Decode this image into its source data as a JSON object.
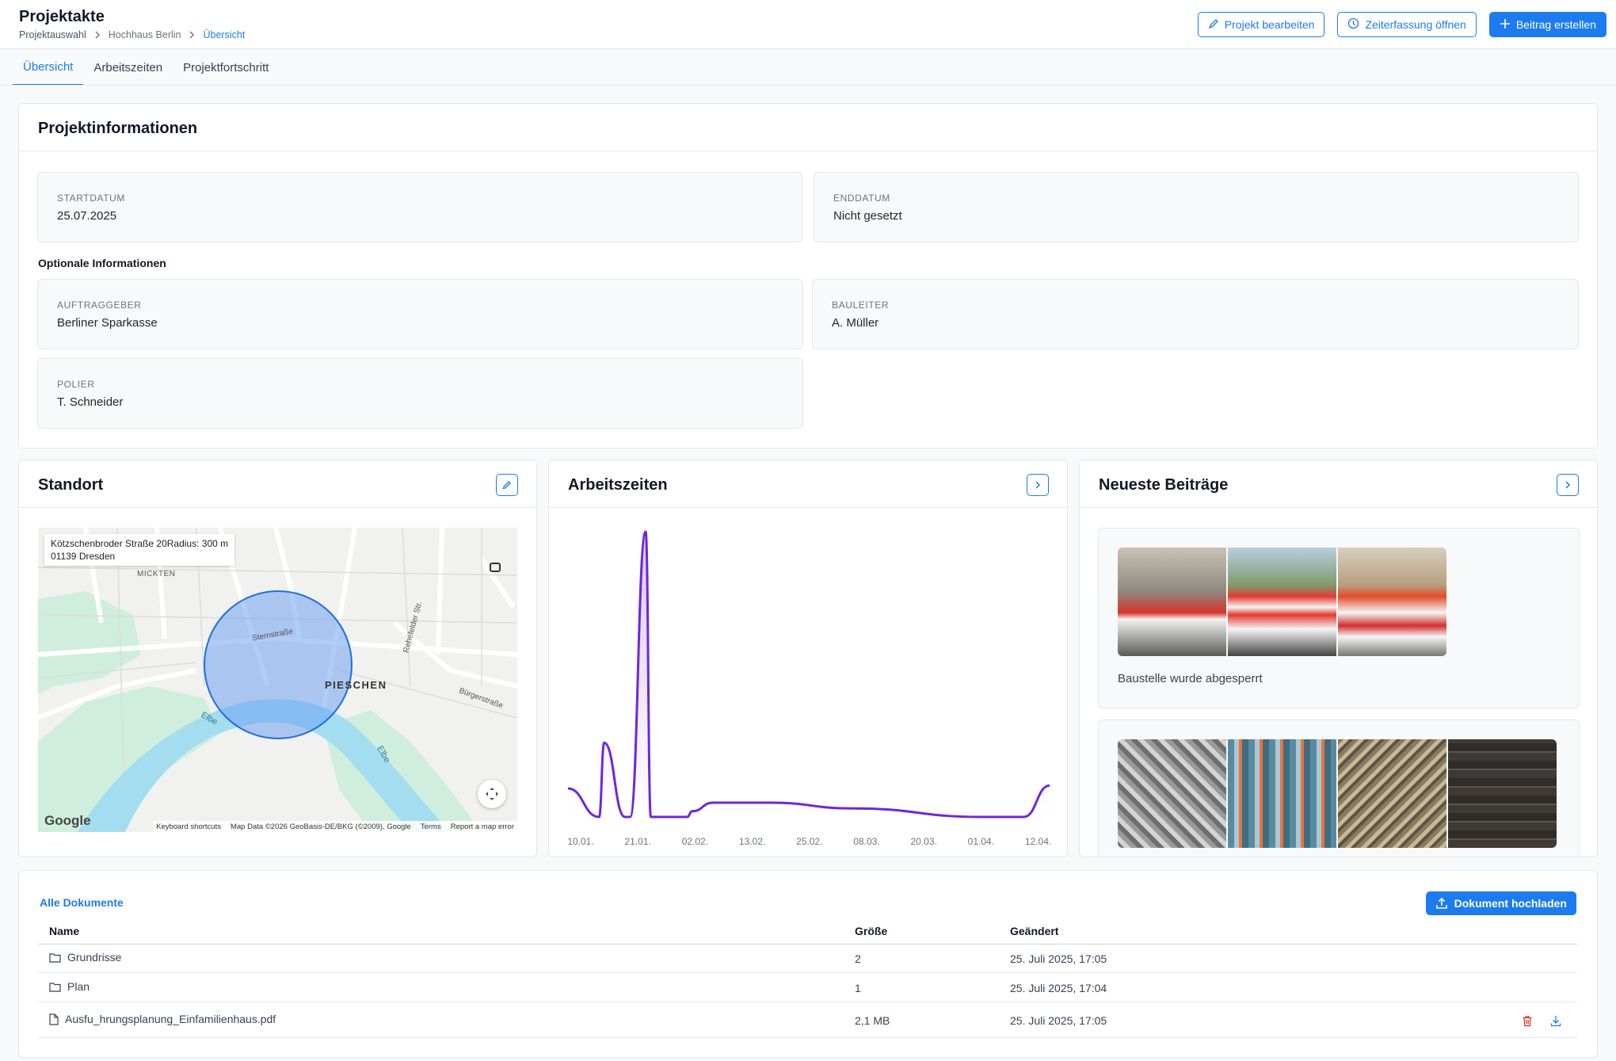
{
  "header": {
    "title": "Projektakte",
    "breadcrumb": [
      "Projektauswahl",
      "Hochhaus Berlin",
      "Übersicht"
    ],
    "actions": {
      "edit": "Projekt bearbeiten",
      "time": "Zeiterfassung öffnen",
      "create": "Beitrag erstellen"
    }
  },
  "tabs": [
    "Übersicht",
    "Arbeitszeiten",
    "Projektfortschritt"
  ],
  "project_info": {
    "title": "Projektinformationen",
    "start_label": "STARTDATUM",
    "start_value": "25.07.2025",
    "end_label": "ENDDATUM",
    "end_value": "Nicht gesetzt",
    "optional_title": "Optionale Informationen",
    "client_label": "AUFTRAGGEBER",
    "client_value": "Berliner Sparkasse",
    "manager_label": "BAULEITER",
    "manager_value": "A. Müller",
    "foreman_label": "POLIER",
    "foreman_value": "T. Schneider"
  },
  "location": {
    "title": "Standort",
    "address_line1": "Kötzschenbroder Straße 20Radius: 300 m",
    "address_line2": "01139 Dresden",
    "labels": {
      "mickten": "MICKTEN",
      "pieschen": "PIESCHEN",
      "sternstrasse": "Sternstraße",
      "rehefelder": "Rehefelder Str.",
      "buergerstrasse": "Bürgerstraße",
      "elbe1": "Elbe",
      "elbe2": "Elbe"
    },
    "google": "Google",
    "footer": [
      "Keyboard shortcuts",
      "Map Data ©2026 GeoBasis-DE/BKG (©2009), Google",
      "Terms",
      "Report a map error"
    ]
  },
  "worktime": {
    "title": "Arbeitszeiten"
  },
  "chart_data": {
    "type": "area",
    "x_ticks": [
      "10.01.",
      "21.01.",
      "02.02.",
      "13.02.",
      "25.02.",
      "08.03.",
      "20.03.",
      "01.04.",
      "12.04."
    ],
    "x": [
      0,
      6,
      7,
      11,
      12,
      15,
      16,
      23,
      24,
      28,
      39,
      55,
      80,
      88,
      93
    ],
    "values": [
      0.1,
      0.0,
      0.26,
      0.0,
      0.0,
      1.0,
      0.0,
      0.0,
      0.02,
      0.05,
      0.05,
      0.03,
      0.0,
      0.0,
      0.11
    ],
    "color": "#6d28d9"
  },
  "posts": {
    "title": "Neueste Beiträge",
    "items": [
      {
        "text": "Baustelle wurde abgesperrt"
      },
      {
        "text": ""
      }
    ]
  },
  "documents": {
    "link": "Alle Dokumente",
    "upload": "Dokument hochladen",
    "columns": [
      "Name",
      "Größe",
      "Geändert"
    ],
    "rows": [
      {
        "type": "folder",
        "name": "Grundrisse",
        "size": "2",
        "changed": "25. Juli 2025, 17:05"
      },
      {
        "type": "folder",
        "name": "Plan",
        "size": "1",
        "changed": "25. Juli 2025, 17:04"
      },
      {
        "type": "file",
        "name": "Ausfu_hrungsplanung_Einfamilienhaus.pdf",
        "size": "2,1 MB",
        "changed": "25. Juli 2025, 17:05"
      }
    ]
  },
  "colors": {
    "accent": "#1d7bf0",
    "chart_line": "#6d28d9",
    "danger": "#dc2626"
  }
}
